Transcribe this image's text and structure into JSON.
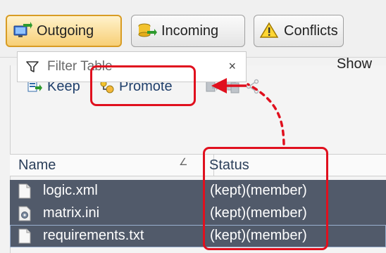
{
  "views": {
    "outgoing_label": "Outgoing",
    "incoming_label": "Incoming",
    "conflicts_label": "Conflicts"
  },
  "toolbar": {
    "keep_label": "Keep",
    "promote_label": "Promote"
  },
  "filter": {
    "placeholder": "Filter Table",
    "clear_glyph": "×",
    "show_label": "Show"
  },
  "table": {
    "columns": {
      "name": "Name",
      "status": "Status"
    },
    "rows": [
      {
        "name": "logic.xml",
        "status": "(kept)(member)",
        "icon": "document-icon"
      },
      {
        "name": "matrix.ini",
        "status": "(kept)(member)",
        "icon": "settings-file-icon"
      },
      {
        "name": "requirements.txt",
        "status": "(kept)(member)",
        "icon": "document-icon"
      }
    ]
  },
  "colors": {
    "active_tab": "#f7cf76",
    "row_selected": "#515a6a",
    "annotation": "#e0101e"
  }
}
